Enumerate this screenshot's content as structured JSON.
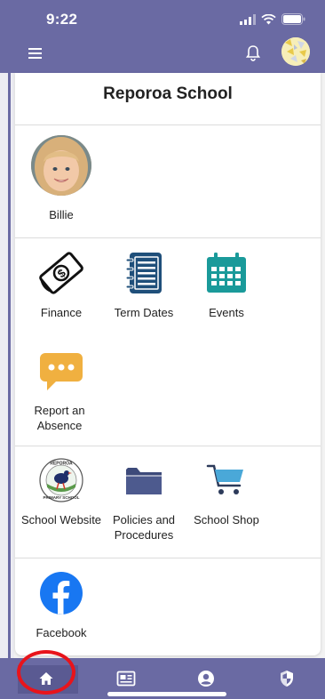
{
  "status_bar": {
    "time": "9:22"
  },
  "header": {
    "menu_icon": "hamburger-menu-icon",
    "bell_icon": "bell-icon",
    "avatar_icon": "profile-avatar"
  },
  "school": {
    "name": "Reporoa School"
  },
  "student": {
    "name": "Billie"
  },
  "tiles_row1": [
    {
      "label": "Finance",
      "icon": "money-icon"
    },
    {
      "label": "Term Dates",
      "icon": "notebook-icon"
    },
    {
      "label": "Events",
      "icon": "calendar-icon"
    }
  ],
  "tiles_row2": [
    {
      "label": "Report an Absence",
      "icon": "chat-bubble-icon"
    }
  ],
  "tiles_row3": [
    {
      "label": "School Website",
      "icon": "school-logo"
    },
    {
      "label": "Policies and Procedures",
      "icon": "folder-icon"
    },
    {
      "label": "School Shop",
      "icon": "cart-icon"
    }
  ],
  "tiles_row4": [
    {
      "label": "Facebook",
      "icon": "facebook-icon"
    }
  ],
  "bottom_nav": [
    {
      "name": "home",
      "icon": "home-icon"
    },
    {
      "name": "news",
      "icon": "newspaper-icon"
    },
    {
      "name": "account",
      "icon": "account-icon"
    },
    {
      "name": "privacy",
      "icon": "shield-icon"
    }
  ],
  "colors": {
    "primary": "#6a6aa3",
    "events_teal": "#1a9a9a",
    "absence_orange": "#f0b040",
    "folder_navy": "#3d4a7a",
    "cart_blue": "#4aa8d8",
    "facebook_blue": "#1877f2",
    "highlight_red": "#e8141b"
  }
}
